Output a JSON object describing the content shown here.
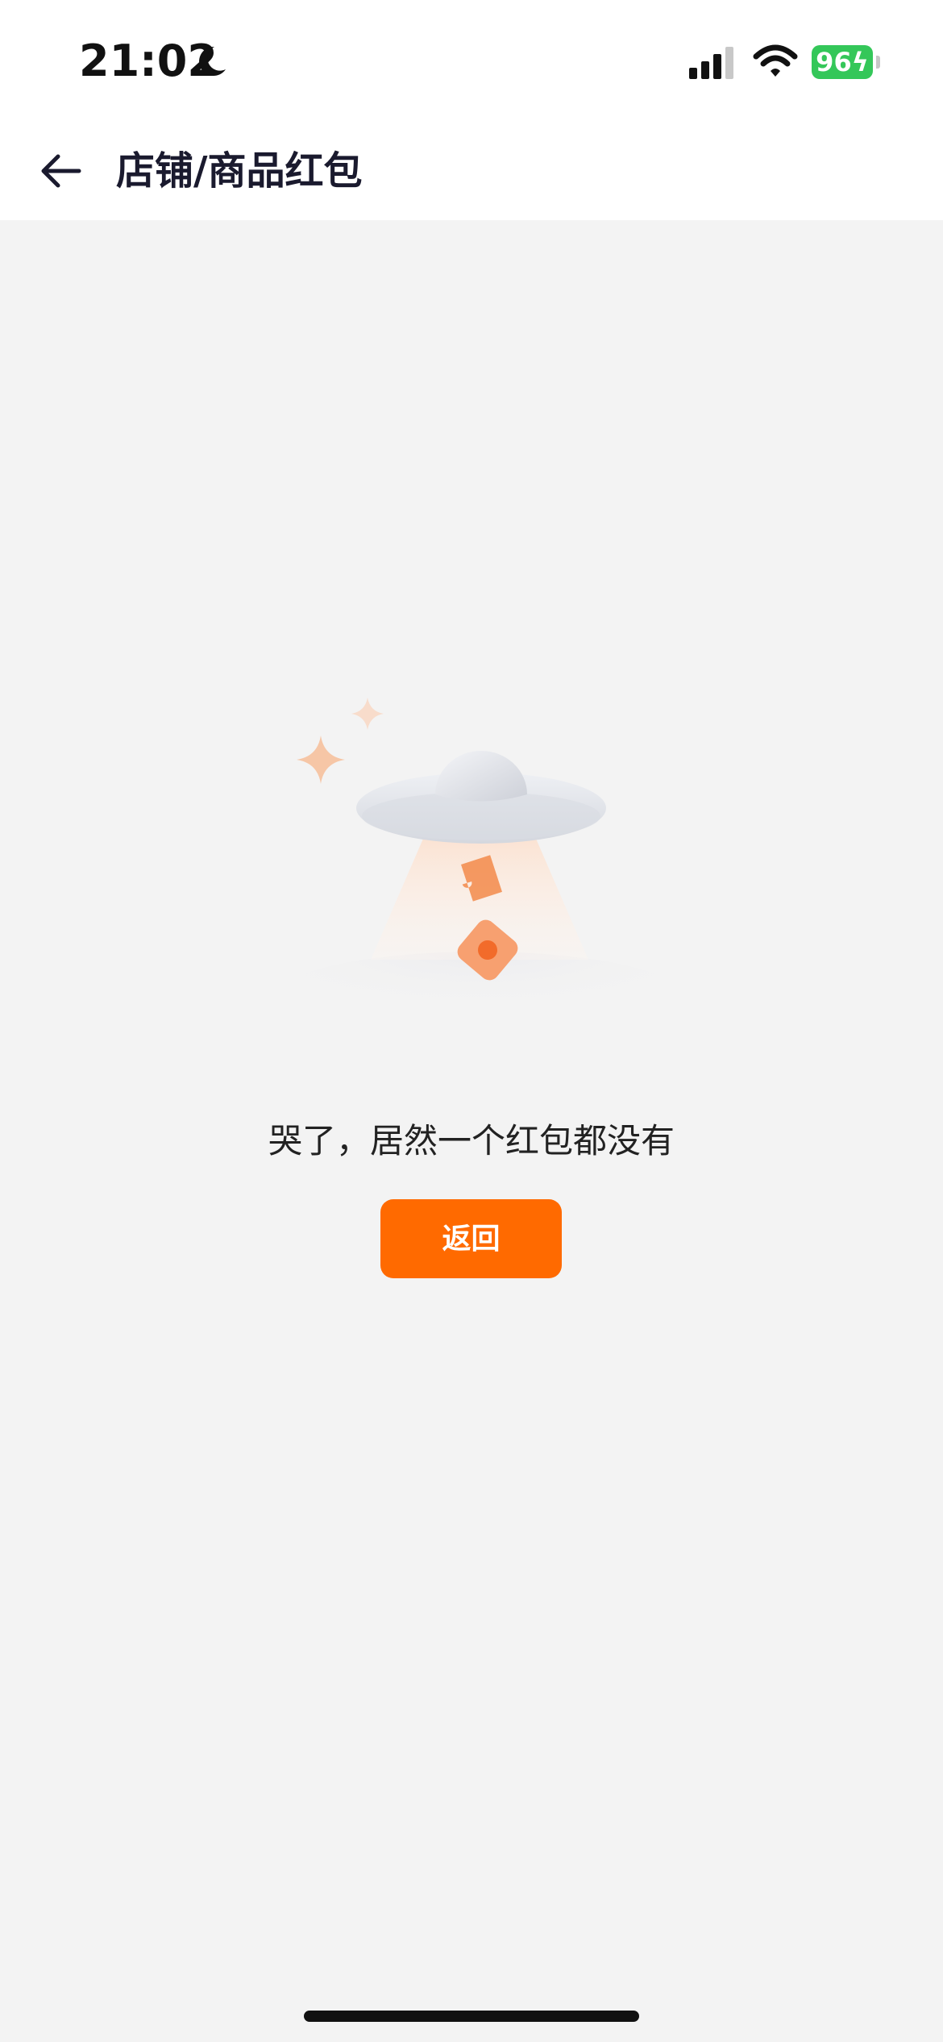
{
  "status_bar": {
    "time": "21:02",
    "battery_level": "96",
    "icons": [
      "moon-icon",
      "signal-icon",
      "wifi-icon",
      "battery-icon"
    ]
  },
  "header": {
    "title": "店铺/商品红包",
    "back_icon": "back-arrow-icon"
  },
  "empty_state": {
    "illustration": "ufo-red-packet-illustration",
    "message": "哭了，居然一个红包都没有",
    "button_label": "返回"
  },
  "colors": {
    "accent": "#ff6a00",
    "battery": "#34c759",
    "background": "#f3f3f3"
  }
}
